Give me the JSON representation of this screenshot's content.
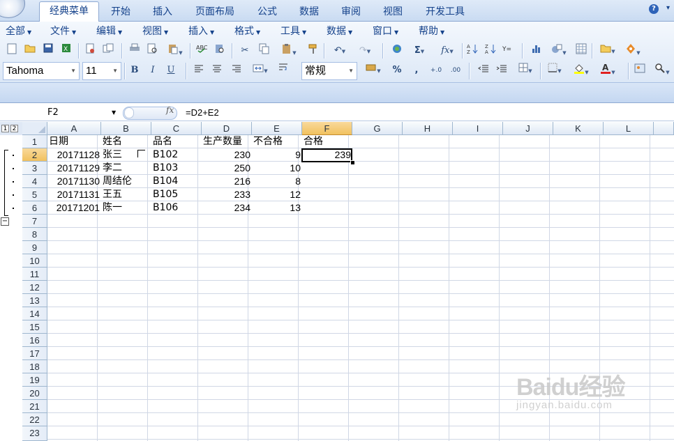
{
  "ribbon": {
    "tabs": [
      "经典菜单",
      "开始",
      "插入",
      "页面布局",
      "公式",
      "数据",
      "审阅",
      "视图",
      "开发工具"
    ],
    "active_tab": "经典菜单",
    "menus": [
      "全部",
      "文件",
      "编辑",
      "视图",
      "插入",
      "格式",
      "工具",
      "数据",
      "窗口",
      "帮助"
    ]
  },
  "toolbar": {
    "font_name": "Tahoma",
    "font_size": "11",
    "number_format": "常规",
    "bold": "B",
    "italic": "I",
    "underline": "U",
    "percent": "%",
    "comma": ",",
    "sum": "Σ"
  },
  "formula_bar": {
    "name_box": "F2",
    "fx_label": "fx",
    "formula": "=D2+E2"
  },
  "outline": {
    "levels": [
      "1",
      "2"
    ],
    "collapse": "−"
  },
  "sheet": {
    "columns": [
      "A",
      "B",
      "C",
      "D",
      "E",
      "F",
      "G",
      "H",
      "I",
      "J",
      "K",
      "L"
    ],
    "rows": [
      "1",
      "2",
      "3",
      "4",
      "5",
      "6",
      "7",
      "8",
      "9",
      "10",
      "11",
      "12",
      "13",
      "14",
      "15",
      "16",
      "17",
      "18",
      "19",
      "20",
      "21",
      "22",
      "23"
    ],
    "selected_cell": "F2",
    "header": [
      "日期",
      "姓名",
      "品名",
      "生产数量",
      "不合格",
      "合格"
    ],
    "data": [
      [
        "20171128",
        "张三",
        "B102",
        "230",
        "9",
        "239"
      ],
      [
        "20171129",
        "李二",
        "B103",
        "250",
        "10",
        ""
      ],
      [
        "20171130",
        "周结伦",
        "B104",
        "216",
        "8",
        ""
      ],
      [
        "20171131",
        "王五",
        "B105",
        "233",
        "12",
        ""
      ],
      [
        "20171201",
        "陈一",
        "B106",
        "234",
        "13",
        ""
      ]
    ]
  },
  "watermark": {
    "main": "Baidu经验",
    "sub": "jingyan.baidu.com"
  }
}
